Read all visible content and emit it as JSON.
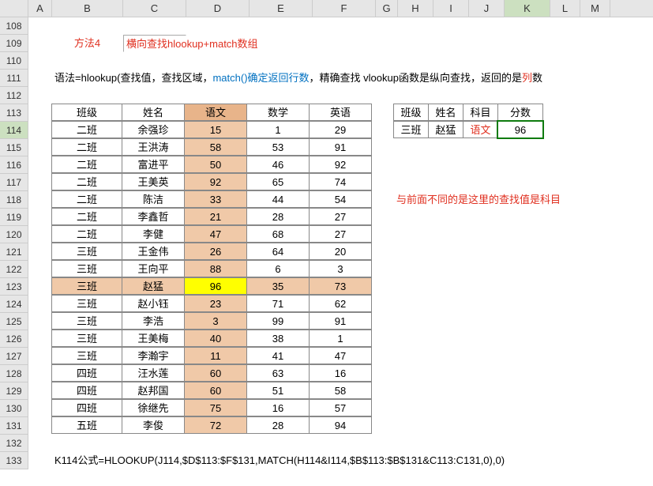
{
  "columns": [
    "A",
    "B",
    "C",
    "D",
    "E",
    "F",
    "G",
    "H",
    "I",
    "J",
    "K",
    "L",
    "M"
  ],
  "row_start": 108,
  "row_end": 133,
  "selected_col": "K",
  "selected_row": 114,
  "method_label": "方法4",
  "title": "横向查找hlookup+match数组",
  "syntax": {
    "prefix": "语法=hlookup(查找值，查找区域，",
    "blue": "match()确定返回行数",
    "suffix": "，精确查找 vlookup函数是纵向查找，返回的是",
    "red_tail": "列",
    "suffix2": "数"
  },
  "main_headers": [
    "班级",
    "姓名",
    "语文",
    "数学",
    "英语"
  ],
  "main_rows": [
    {
      "班级": "二班",
      "姓名": "余强珍",
      "语文": "15",
      "数学": "1",
      "英语": "29"
    },
    {
      "班级": "二班",
      "姓名": "王洪涛",
      "语文": "58",
      "数学": "53",
      "英语": "91"
    },
    {
      "班级": "二班",
      "姓名": "富进平",
      "语文": "50",
      "数学": "46",
      "英语": "92"
    },
    {
      "班级": "二班",
      "姓名": "王美英",
      "语文": "92",
      "数学": "65",
      "英语": "74"
    },
    {
      "班级": "二班",
      "姓名": "陈洁",
      "语文": "33",
      "数学": "44",
      "英语": "54"
    },
    {
      "班级": "二班",
      "姓名": "李鑫哲",
      "语文": "21",
      "数学": "28",
      "英语": "27"
    },
    {
      "班级": "二班",
      "姓名": "李健",
      "语文": "47",
      "数学": "68",
      "英语": "27"
    },
    {
      "班级": "三班",
      "姓名": "王金伟",
      "语文": "26",
      "数学": "64",
      "英语": "20"
    },
    {
      "班级": "三班",
      "姓名": "王向平",
      "语文": "88",
      "数学": "6",
      "英语": "3"
    },
    {
      "班级": "三班",
      "姓名": "赵猛",
      "语文": "96",
      "数学": "35",
      "英语": "73",
      "hl": true
    },
    {
      "班级": "三班",
      "姓名": "赵小钰",
      "语文": "23",
      "数学": "71",
      "英语": "62"
    },
    {
      "班级": "三班",
      "姓名": "李浩",
      "语文": "3",
      "数学": "99",
      "英语": "91"
    },
    {
      "班级": "三班",
      "姓名": "王美梅",
      "语文": "40",
      "数学": "38",
      "英语": "1"
    },
    {
      "班级": "三班",
      "姓名": "李瀚宇",
      "语文": "11",
      "数学": "41",
      "英语": "47"
    },
    {
      "班级": "四班",
      "姓名": "汪水莲",
      "语文": "60",
      "数学": "63",
      "英语": "16"
    },
    {
      "班级": "四班",
      "姓名": "赵邦国",
      "语文": "60",
      "数学": "51",
      "英语": "58"
    },
    {
      "班级": "四班",
      "姓名": "徐继先",
      "语文": "75",
      "数学": "16",
      "英语": "57"
    },
    {
      "班级": "五班",
      "姓名": "李俊",
      "语文": "72",
      "数学": "28",
      "英语": "94"
    }
  ],
  "side_headers": [
    "班级",
    "姓名",
    "科目",
    "分数"
  ],
  "side_row": {
    "班级": "三班",
    "姓名": "赵猛",
    "科目": "语文",
    "分数": "96"
  },
  "note_red": "与前面不同的是这里的查找值是科目",
  "formula_text": "K114公式=HLOOKUP(J114,$D$113:$F$131,MATCH(H114&I114,$B$113:$B$131&C113:C131,0),0)"
}
